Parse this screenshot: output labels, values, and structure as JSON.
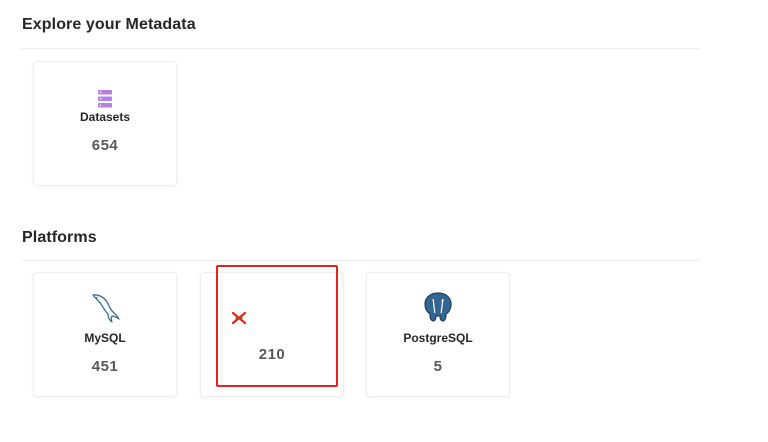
{
  "sections": {
    "explore": {
      "title": "Explore your Metadata"
    },
    "platforms": {
      "title": "Platforms"
    }
  },
  "cards": {
    "datasets": {
      "label": "Datasets",
      "count": "654",
      "icon": "database-stack-icon",
      "icon_color": "#b37feb"
    },
    "mysql": {
      "label": "MySQL",
      "count": "451",
      "icon": "mysql-dolphin-icon",
      "icon_color": "#3a6e8f"
    },
    "unknown": {
      "label": "",
      "count": "210",
      "icon": "platform-x-icon",
      "icon_color": "#e0241b"
    },
    "postgresql": {
      "label": "PostgreSQL",
      "count": "5",
      "icon": "postgresql-elephant-icon",
      "icon_color": "#336791"
    }
  },
  "colors": {
    "highlight": "#e0241b",
    "datasets_icon": "#b37feb",
    "divider": "#ececec"
  }
}
